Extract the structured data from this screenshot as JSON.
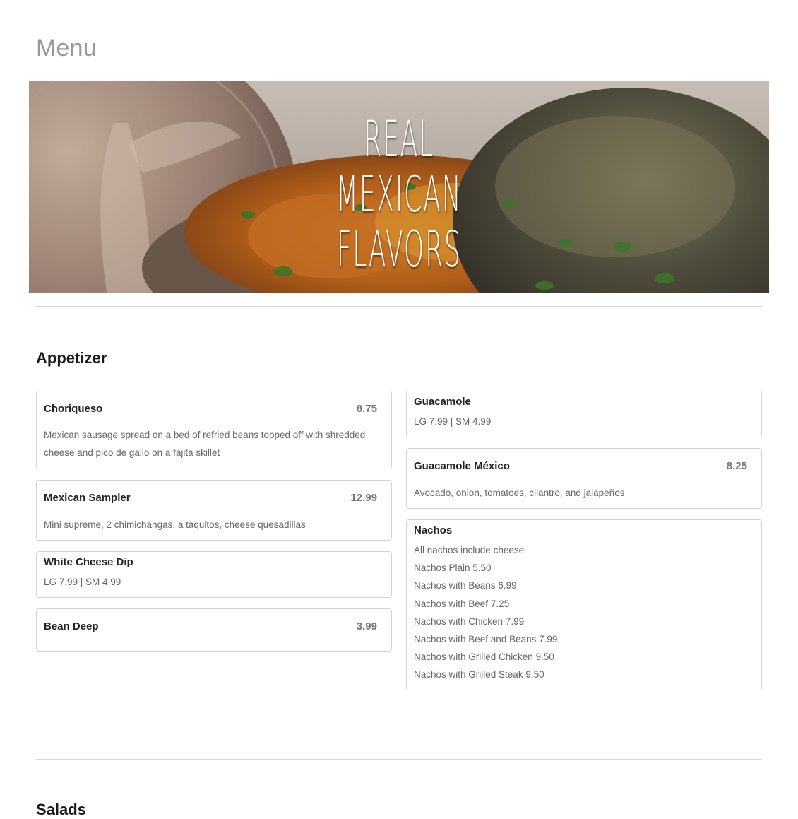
{
  "page": {
    "title": "Menu"
  },
  "hero": {
    "lines": [
      "Real",
      "Mexican",
      "Flavors"
    ],
    "image": "food-banner"
  },
  "sections": [
    {
      "title": "Appetizer",
      "left_column": [
        {
          "name": "Choriqueso",
          "price": "8.75",
          "description": "Mexican sausage spread on a bed of refried beans topped off with shredded cheese and pico de gallo on a fajita skillet"
        },
        {
          "name": "Mexican Sampler",
          "price": "12.99",
          "description": "Mini supreme, 2 chimichangas, a taquitos, cheese quesadillas"
        },
        {
          "name": "White Cheese Dip",
          "price": "",
          "description": "LG 7.99 | SM 4.99"
        },
        {
          "name": "Bean Deep",
          "price": "3.99",
          "description": ""
        }
      ],
      "right_column": [
        {
          "name": "Guacamole",
          "price": "",
          "description": "LG 7.99 | SM 4.99"
        },
        {
          "name": "Guacamole México",
          "price": "8.25",
          "description": "Avocado, onion, tomatoes, cilantro, and jalapeños"
        },
        {
          "name": "Nachos",
          "price": "",
          "lines": [
            "All nachos include cheese",
            "Nachos Plain 5.50",
            "Nachos with Beans 6.99",
            "Nachos with Beef 7.25",
            "Nachos with Chicken 7.99",
            "Nachos with Beef and Beans 7.99",
            "Nachos with Grilled Chicken 9.50",
            "Nachos with Grilled Steak 9.50"
          ]
        }
      ]
    },
    {
      "title": "Salads"
    }
  ],
  "colors": {
    "title_grey": "#999999",
    "card_border": "#d4d4d4",
    "price_grey": "#777777",
    "desc_grey": "#666666",
    "rule": "#d8d8d8"
  }
}
